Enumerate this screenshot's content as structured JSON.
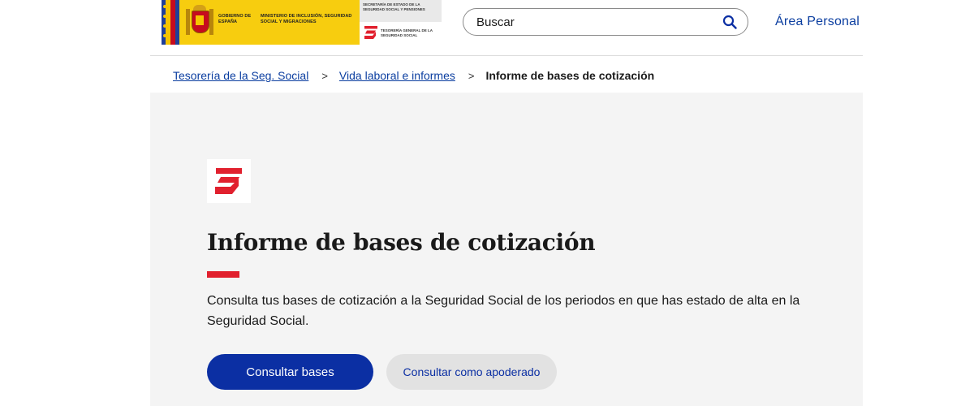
{
  "header": {
    "gov_label": "GOBIERNO DE ESPAÑA",
    "ministry_label": "MINISTERIO DE INCLUSIÓN, SEGURIDAD SOCIAL Y MIGRACIONES",
    "secretary_label": "SECRETARÍA DE ESTADO DE LA SEGURIDAD SOCIAL Y PENSIONES",
    "tgss_label": "TESORERÍA GENERAL DE LA SEGURIDAD SOCIAL",
    "search": {
      "placeholder": "Buscar",
      "value": ""
    },
    "area_personal_label": "Área Personal"
  },
  "breadcrumb": {
    "items": [
      {
        "label": "Tesorería de la Seg. Social"
      },
      {
        "label": "Vida laboral e informes"
      }
    ],
    "separator": ">",
    "current": "Informe de bases de cotización"
  },
  "main": {
    "title": "Informe de bases de cotización",
    "description": "Consulta tus bases de cotización a la Seguridad Social de los periodos en que has estado de alta en la Seguridad Social.",
    "primary_button_label": "Consultar bases",
    "secondary_button_label": "Consultar como apoderado"
  },
  "icons": {
    "search": "search-icon",
    "tgss_logo": "tgss-logo",
    "coat_of_arms": "coat-of-arms-icon"
  },
  "colors": {
    "primary": "#0b2fa3",
    "link": "#0b3ea0",
    "accent_red": "#e1202e",
    "gov_yellow": "#f7cd0f",
    "panel_bg": "#f4f4f4"
  }
}
